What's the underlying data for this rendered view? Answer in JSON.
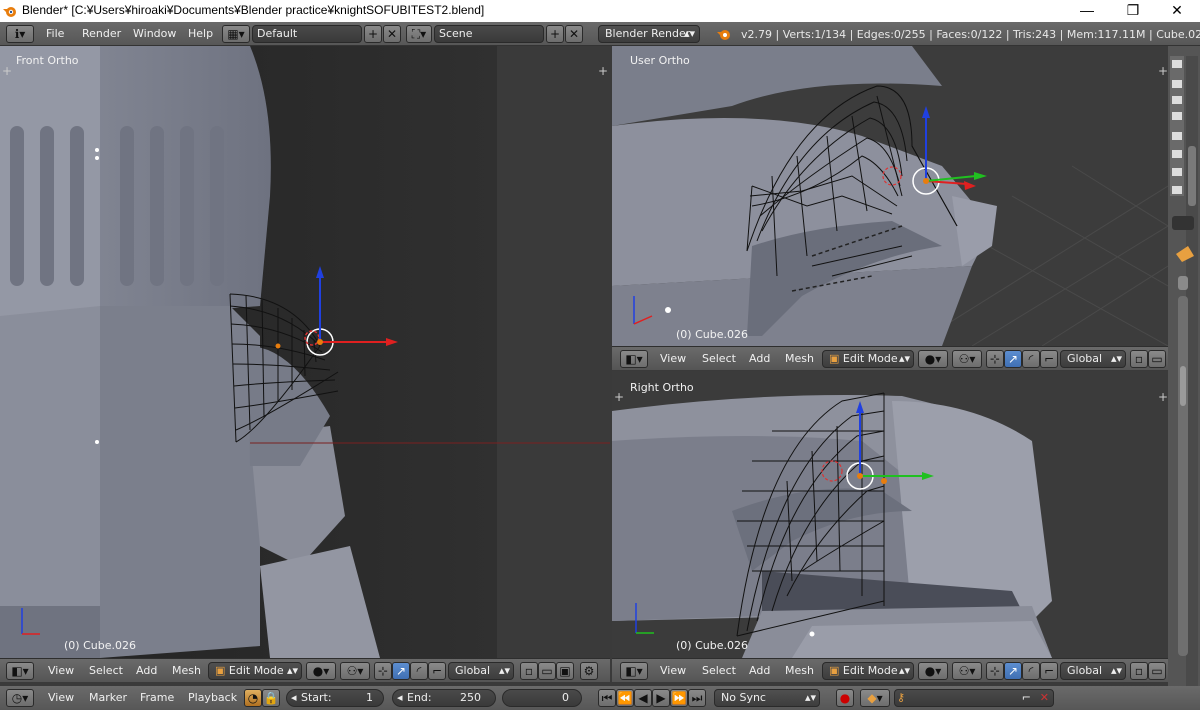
{
  "titlebar": {
    "title": "Blender* [C:¥Users¥hiroaki¥Documents¥Blender practice¥knightSOFUBITEST2.blend]",
    "minimize": "—",
    "maximize": "❐",
    "close": "✕"
  },
  "info": {
    "menus": [
      "File",
      "Render",
      "Window",
      "Help"
    ],
    "layout": "Default",
    "scene": "Scene",
    "engine": "Blender Render",
    "stats": "v2.79 | Verts:1/134 | Edges:0/255 | Faces:0/122 | Tris:243 | Mem:117.11M | Cube.026"
  },
  "viewports": {
    "front": {
      "label": "Front Ortho",
      "object": "(0) Cube.026"
    },
    "user": {
      "label": "User Ortho",
      "object": "(0) Cube.026"
    },
    "right": {
      "label": "Right Ortho",
      "object": "(0) Cube.026"
    }
  },
  "view3d_header": {
    "view": "View",
    "select": "Select",
    "add": "Add",
    "mesh": "Mesh",
    "mode": "Edit Mode",
    "orientation": "Global"
  },
  "timeline": {
    "view": "View",
    "marker": "Marker",
    "frame": "Frame",
    "playback": "Playback",
    "start_label": "Start:",
    "start": "1",
    "end_label": "End:",
    "end": "250",
    "current": "0",
    "sync": "No Sync"
  },
  "colors": {
    "accent": "#5680c2",
    "x_axis": "#e02020",
    "y_axis": "#20c020",
    "z_axis": "#2040e0",
    "bg": "#3d3d3d"
  }
}
